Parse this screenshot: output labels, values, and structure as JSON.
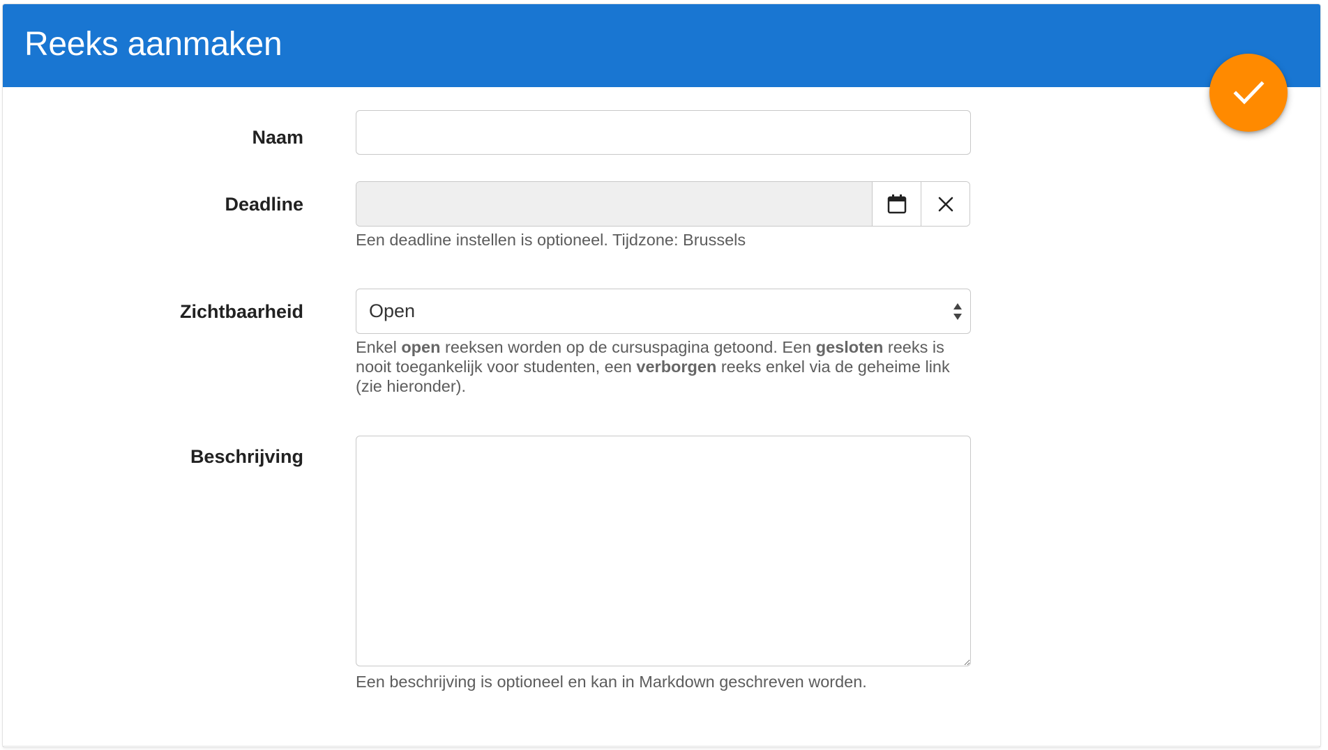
{
  "header": {
    "title": "Reeks aanmaken",
    "color": "#1976d2"
  },
  "submit_button": {
    "icon": "check-icon",
    "color": "#ff8a00"
  },
  "form": {
    "name": {
      "label": "Naam",
      "value": ""
    },
    "deadline": {
      "label": "Deadline",
      "value": "",
      "calendar_icon": "calendar-icon",
      "clear_icon": "close-icon",
      "help": "Een deadline instellen is optioneel. Tijdzone: Brussels"
    },
    "visibility": {
      "label": "Zichtbaarheid",
      "selected": "Open",
      "help": {
        "p1": "Enkel ",
        "b1": "open",
        "p2": " reeksen worden op de cursuspagina getoond. Een ",
        "b2": "gesloten",
        "p3": " reeks is nooit toegankelijk voor studenten, een ",
        "b3": "verborgen",
        "p4": " reeks enkel via de geheime link (zie hieronder)."
      }
    },
    "description": {
      "label": "Beschrijving",
      "value": "",
      "help": "Een beschrijving is optioneel en kan in Markdown geschreven worden."
    }
  }
}
